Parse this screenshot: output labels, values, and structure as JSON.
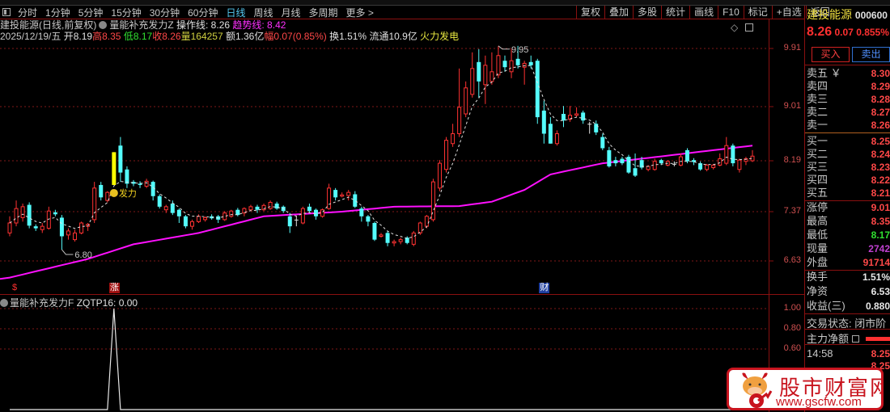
{
  "menu": {
    "tabs": [
      "分时",
      "1分钟",
      "5分钟",
      "15分钟",
      "30分钟",
      "60分钟",
      "日线",
      "周线",
      "月线",
      "多周期",
      "更多 >"
    ],
    "active": "日线"
  },
  "toolbar": [
    "复权",
    "叠加",
    "多股",
    "统计",
    "画线",
    "F10",
    "标记",
    "+自选",
    "返回"
  ],
  "info1": {
    "title": "建投能源(日线,前复权)",
    "indicator": "量能补充发力Z",
    "op_line": "操作线: 8.26",
    "trend_line": "趋势线: 8.42"
  },
  "info2": {
    "date": "2025/12/19/五",
    "open": "开8.19",
    "high_l": "高",
    "high": "8.35",
    "low_l": "低",
    "low": "8.17",
    "close_l": "收",
    "close": "8.26",
    "vol_l": "量",
    "vol": "164257",
    "amount": "额1.36亿",
    "chg_l": "幅",
    "chg": "0.07(0.85%)",
    "turnover": "换1.51%",
    "float": "流通10.9亿",
    "sector": "火力发电"
  },
  "lower_label": {
    "indicator": "量能补充发力F",
    "value": "ZQTP16: 0.00"
  },
  "markers": [
    {
      "text": "$",
      "index": 1,
      "color": "#ff3030",
      "bg": "transparent"
    },
    {
      "text": "涨",
      "index": 16,
      "color": "#ffffff",
      "bg": "#a01010"
    },
    {
      "text": "财",
      "index": 82,
      "color": "#ffffff",
      "bg": "#2040a0"
    }
  ],
  "annotations": {
    "high": "9.95",
    "low": "6.80",
    "signal": "发力"
  },
  "stock": {
    "name": "建投能源",
    "code": "000600",
    "price": "8.26",
    "change": "0.07",
    "change_pct": "0.855%"
  },
  "buttons": {
    "buy": "买入",
    "sell": "卖出"
  },
  "orderbook": {
    "sells": [
      {
        "l": "卖五 ￥",
        "v": "8.30"
      },
      {
        "l": "卖四",
        "v": "8.29"
      },
      {
        "l": "卖三",
        "v": "8.28"
      },
      {
        "l": "卖二",
        "v": "8.27"
      },
      {
        "l": "卖一",
        "v": "8.26"
      }
    ],
    "buys": [
      {
        "l": "买一",
        "v": "8.25"
      },
      {
        "l": "买二",
        "v": "8.24"
      },
      {
        "l": "买三",
        "v": "8.23"
      },
      {
        "l": "买四",
        "v": "8.22"
      },
      {
        "l": "买五",
        "v": "8.21"
      }
    ]
  },
  "quote": [
    {
      "l": "涨停",
      "v": "9.01",
      "c": "#ff4848"
    },
    {
      "l": "最高",
      "v": "8.35",
      "c": "#ff4848"
    },
    {
      "l": "最低",
      "v": "8.17",
      "c": "#30e030"
    },
    {
      "l": "现量",
      "v": "2742",
      "c": "#c040d0"
    },
    {
      "l": "外盘",
      "v": "91714",
      "c": "#ff4848"
    }
  ],
  "fund": [
    {
      "l": "换手",
      "v": "1.51%"
    },
    {
      "l": "净资",
      "v": "6.53"
    },
    {
      "l": "收益(三)",
      "v": "0.880"
    }
  ],
  "status": "交易状态: 闭市阶",
  "main_net": "主力净额",
  "ticks": [
    {
      "t": "14:58",
      "v": "8.25"
    },
    {
      "t": "",
      "v": "8.25"
    }
  ],
  "watermark": {
    "name": "股市财富网",
    "url": "www.gscfw.com"
  },
  "colors": {
    "up": "#ff3232",
    "down": "#54fcfc",
    "signal": "#ffff00",
    "trend": "#ff10ff",
    "grid": "#801818"
  },
  "chart_data": {
    "type": "candlestick",
    "y_ticks": [
      "9.91",
      "9.01",
      "8.19",
      "7.37",
      "6.63"
    ],
    "lower_y_ticks": [
      "1.00",
      "0.80",
      "0.60"
    ],
    "signal_index": 16,
    "ohlc": [
      [
        7.05,
        7.3,
        7.0,
        7.2
      ],
      [
        7.2,
        7.55,
        7.15,
        7.42
      ],
      [
        7.28,
        7.5,
        7.22,
        7.45
      ],
      [
        7.48,
        7.52,
        7.12,
        7.16
      ],
      [
        7.15,
        7.18,
        7.08,
        7.12
      ],
      [
        7.1,
        7.2,
        7.05,
        7.15
      ],
      [
        7.12,
        7.45,
        7.1,
        7.38
      ],
      [
        7.36,
        7.4,
        7.3,
        7.33
      ],
      [
        7.28,
        7.32,
        6.8,
        7.0
      ],
      [
        7.02,
        7.12,
        6.95,
        7.08
      ],
      [
        6.95,
        7.1,
        6.92,
        7.05
      ],
      [
        7.05,
        7.22,
        7.03,
        7.2
      ],
      [
        7.15,
        7.2,
        7.08,
        7.18
      ],
      [
        7.25,
        7.85,
        7.2,
        7.75
      ],
      [
        7.8,
        7.85,
        7.55,
        7.6
      ],
      [
        7.55,
        7.7,
        7.52,
        7.68
      ],
      [
        7.8,
        8.32,
        7.8,
        8.32
      ],
      [
        8.42,
        8.55,
        7.85,
        8.0
      ],
      [
        8.05,
        8.1,
        7.75,
        7.82
      ],
      [
        7.85,
        7.88,
        7.78,
        7.82
      ],
      [
        7.82,
        7.86,
        7.75,
        7.8
      ],
      [
        7.78,
        7.9,
        7.75,
        7.86
      ],
      [
        7.85,
        7.87,
        7.55,
        7.62
      ],
      [
        7.62,
        7.65,
        7.42,
        7.45
      ],
      [
        7.4,
        7.48,
        7.35,
        7.45
      ],
      [
        7.5,
        7.55,
        7.32,
        7.35
      ],
      [
        7.4,
        7.42,
        7.2,
        7.3
      ],
      [
        7.3,
        7.32,
        7.12,
        7.15
      ],
      [
        7.15,
        7.25,
        7.1,
        7.22
      ],
      [
        7.22,
        7.33,
        7.2,
        7.3
      ],
      [
        7.25,
        7.3,
        7.22,
        7.28
      ],
      [
        7.3,
        7.33,
        7.25,
        7.27
      ],
      [
        7.3,
        7.32,
        7.2,
        7.25
      ],
      [
        7.25,
        7.38,
        7.23,
        7.35
      ],
      [
        7.3,
        7.4,
        7.28,
        7.38
      ],
      [
        7.4,
        7.43,
        7.3,
        7.32
      ],
      [
        7.35,
        7.44,
        7.3,
        7.42
      ],
      [
        7.4,
        7.48,
        7.38,
        7.45
      ],
      [
        7.45,
        7.48,
        7.35,
        7.4
      ],
      [
        7.4,
        7.5,
        7.38,
        7.47
      ],
      [
        7.42,
        7.55,
        7.4,
        7.52
      ],
      [
        7.5,
        7.53,
        7.4,
        7.42
      ],
      [
        7.45,
        7.47,
        7.35,
        7.38
      ],
      [
        7.3,
        7.35,
        7.05,
        7.15
      ],
      [
        7.25,
        7.3,
        7.15,
        7.25
      ],
      [
        7.2,
        7.45,
        7.18,
        7.42
      ],
      [
        7.45,
        7.5,
        7.36,
        7.38
      ],
      [
        7.4,
        7.42,
        7.25,
        7.3
      ],
      [
        7.3,
        7.42,
        7.28,
        7.4
      ],
      [
        7.42,
        7.82,
        7.4,
        7.75
      ],
      [
        7.72,
        7.75,
        7.55,
        7.6
      ],
      [
        7.62,
        7.68,
        7.6,
        7.64
      ],
      [
        7.63,
        7.72,
        7.55,
        7.68
      ],
      [
        7.65,
        7.7,
        7.43,
        7.45
      ],
      [
        7.42,
        7.45,
        7.22,
        7.3
      ],
      [
        7.3,
        7.32,
        7.15,
        7.22
      ],
      [
        7.2,
        7.22,
        6.93,
        6.95
      ],
      [
        7.0,
        7.05,
        6.98,
        7.02
      ],
      [
        7.05,
        7.08,
        6.85,
        6.9
      ],
      [
        6.9,
        6.95,
        6.85,
        6.92
      ],
      [
        6.92,
        6.98,
        6.88,
        6.95
      ],
      [
        6.98,
        7.0,
        6.88,
        6.9
      ],
      [
        6.88,
        7.08,
        6.85,
        7.05
      ],
      [
        7.05,
        7.22,
        7.02,
        7.2
      ],
      [
        7.15,
        7.32,
        7.12,
        7.3
      ],
      [
        7.25,
        7.9,
        7.22,
        7.85
      ],
      [
        7.75,
        8.2,
        7.7,
        8.15
      ],
      [
        8.05,
        8.55,
        8.0,
        8.5
      ],
      [
        8.45,
        8.75,
        8.4,
        8.6
      ],
      [
        8.6,
        9.6,
        8.55,
        9.0
      ],
      [
        8.9,
        9.4,
        8.85,
        9.3
      ],
      [
        9.2,
        9.85,
        9.15,
        9.6
      ],
      [
        9.7,
        9.9,
        9.15,
        9.4
      ],
      [
        9.35,
        9.8,
        9.05,
        9.65
      ],
      [
        9.4,
        9.85,
        9.35,
        9.55
      ],
      [
        9.5,
        9.95,
        9.45,
        9.8
      ],
      [
        9.72,
        9.8,
        9.55,
        9.62
      ],
      [
        9.55,
        9.9,
        9.45,
        9.72
      ],
      [
        9.75,
        9.95,
        9.6,
        9.65
      ],
      [
        9.62,
        9.72,
        9.35,
        9.68
      ],
      [
        9.7,
        9.8,
        9.6,
        9.65
      ],
      [
        9.72,
        9.75,
        8.75,
        8.85
      ],
      [
        8.95,
        9.1,
        8.45,
        8.6
      ],
      [
        8.75,
        8.85,
        8.45,
        8.45
      ],
      [
        8.45,
        8.65,
        8.42,
        8.6
      ],
      [
        8.9,
        9.02,
        8.7,
        8.8
      ],
      [
        8.82,
        9.02,
        8.78,
        8.88
      ],
      [
        8.88,
        9.0,
        8.85,
        8.9
      ],
      [
        8.92,
        8.95,
        8.75,
        8.8
      ],
      [
        8.75,
        8.78,
        8.6,
        8.75
      ],
      [
        8.75,
        8.8,
        8.58,
        8.62
      ],
      [
        8.55,
        8.6,
        8.35,
        8.38
      ],
      [
        8.35,
        8.4,
        8.08,
        8.1
      ],
      [
        8.2,
        8.25,
        8.1,
        8.15
      ],
      [
        8.22,
        8.25,
        8.12,
        8.15
      ],
      [
        8.25,
        8.28,
        7.98,
        8.0
      ],
      [
        8.07,
        8.3,
        7.93,
        7.95
      ],
      [
        8.2,
        8.25,
        8.05,
        8.08
      ],
      [
        8.05,
        8.12,
        8.02,
        8.1
      ],
      [
        8.05,
        8.22,
        8.03,
        8.18
      ],
      [
        8.2,
        8.22,
        8.12,
        8.15
      ],
      [
        8.12,
        8.2,
        8.1,
        8.18
      ],
      [
        8.14,
        8.18,
        8.1,
        8.14
      ],
      [
        8.12,
        8.3,
        8.1,
        8.25
      ],
      [
        8.35,
        8.38,
        8.15,
        8.18
      ],
      [
        8.2,
        8.23,
        8.12,
        8.17
      ],
      [
        8.15,
        8.18,
        8.03,
        8.05
      ],
      [
        8.05,
        8.14,
        8.02,
        8.12
      ],
      [
        8.08,
        8.14,
        8.05,
        8.12
      ],
      [
        8.12,
        8.3,
        8.1,
        8.22
      ],
      [
        8.15,
        8.55,
        8.12,
        8.42
      ],
      [
        8.42,
        8.45,
        8.1,
        8.15
      ],
      [
        8.05,
        8.22,
        8.0,
        8.2
      ],
      [
        8.18,
        8.25,
        8.12,
        8.22
      ],
      [
        8.19,
        8.35,
        8.17,
        8.26
      ]
    ],
    "trend_line": [
      [
        0,
        6.38
      ],
      [
        12,
        6.66
      ],
      [
        19,
        6.88
      ],
      [
        29,
        7.05
      ],
      [
        39,
        7.3
      ],
      [
        51,
        7.37
      ],
      [
        59,
        7.45
      ],
      [
        69,
        7.46
      ],
      [
        74,
        7.53
      ],
      [
        79,
        7.72
      ],
      [
        83,
        7.97
      ],
      [
        91,
        8.15
      ],
      [
        96,
        8.21
      ],
      [
        114,
        8.42
      ]
    ]
  }
}
